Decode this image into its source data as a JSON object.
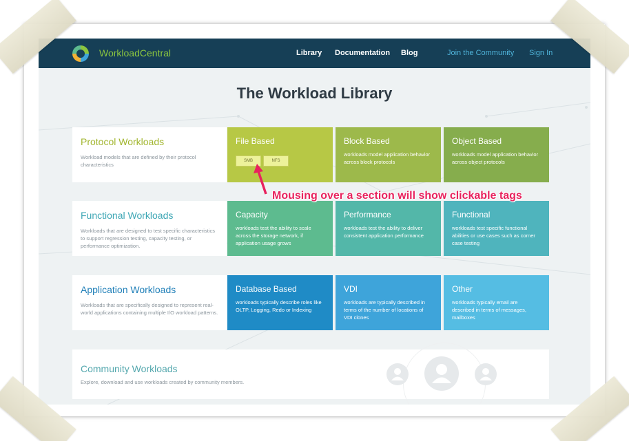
{
  "brand": {
    "name_part1": "Workload",
    "name_part2": "Central"
  },
  "nav": {
    "library": "Library",
    "documentation": "Documentation",
    "blog": "Blog",
    "join": "Join the Community",
    "signin": "Sign In"
  },
  "page_title": "The Workload Library",
  "rows": [
    {
      "title": "Protocol Workloads",
      "desc": "Workload models that are defined by their protocol characteristics",
      "tiles": [
        {
          "title": "File Based",
          "desc": "",
          "tags": [
            "SMB",
            "NFS"
          ]
        },
        {
          "title": "Block Based",
          "desc": "workloads model application behavior across block protocols"
        },
        {
          "title": "Object Based",
          "desc": "workloads model application behavior across object protocols"
        }
      ]
    },
    {
      "title": "Functional Workloads",
      "desc": "Workloads that are designed to test specific characteristics to support regression testing, capacity testing, or performance optimization.",
      "tiles": [
        {
          "title": "Capacity",
          "desc": "workloads test the ability to scale across the storage network, if application usage grows"
        },
        {
          "title": "Performance",
          "desc": "workloads test the ability to deliver consistent application performance"
        },
        {
          "title": "Functional",
          "desc": "workloads test specific functional abilities or use cases such as corner case testing"
        }
      ]
    },
    {
      "title": "Application Workloads",
      "desc": "Workloads that are specifically designed to represent real-world applications containing multiple I/O workload patterns.",
      "tiles": [
        {
          "title": "Database Based",
          "desc": "workloads typically describe roles like OLTP, Logging, Redo or Indexing"
        },
        {
          "title": "VDI",
          "desc": "workloads are typically described in terms of the number of locations of VDI clones"
        },
        {
          "title": "Other",
          "desc": "workloads typically email are described in terms of messages, mailboxes"
        }
      ]
    }
  ],
  "community": {
    "title": "Community Workloads",
    "desc": "Explore, download and use workloads created by community members."
  },
  "annotation": "Mousing over a section will show clickable tags",
  "colors": {
    "nav_bg": "#163f56",
    "brand_green": "#8cc63f",
    "accent_blue": "#4fb3d9",
    "protocol": [
      "#b7c845",
      "#9db94b",
      "#86ad4d"
    ],
    "functional": [
      "#5dbb8f",
      "#53b7a9",
      "#4fb4bd"
    ],
    "application": [
      "#1f8bc6",
      "#3ea4da",
      "#55bde3"
    ],
    "annotation": "#e8235e"
  }
}
